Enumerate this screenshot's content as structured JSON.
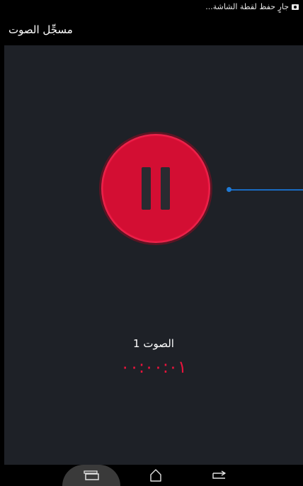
{
  "status_bar": {
    "notification_icon": "screenshot-icon",
    "notification_text": "جارٍ حفظ لقطة الشاشة..."
  },
  "app_bar": {
    "title": "مسجِّل الصوت"
  },
  "recorder": {
    "control_icon": "pause-icon",
    "recording_name": "الصوت 1",
    "timer": "٠٠:٠٠:٠١",
    "accent_color": "#d30e33",
    "waveform_color": "#1a6bc0"
  },
  "nav_bar": {
    "recents_icon": "recents-icon",
    "home_icon": "home-icon",
    "back_icon": "back-icon"
  }
}
